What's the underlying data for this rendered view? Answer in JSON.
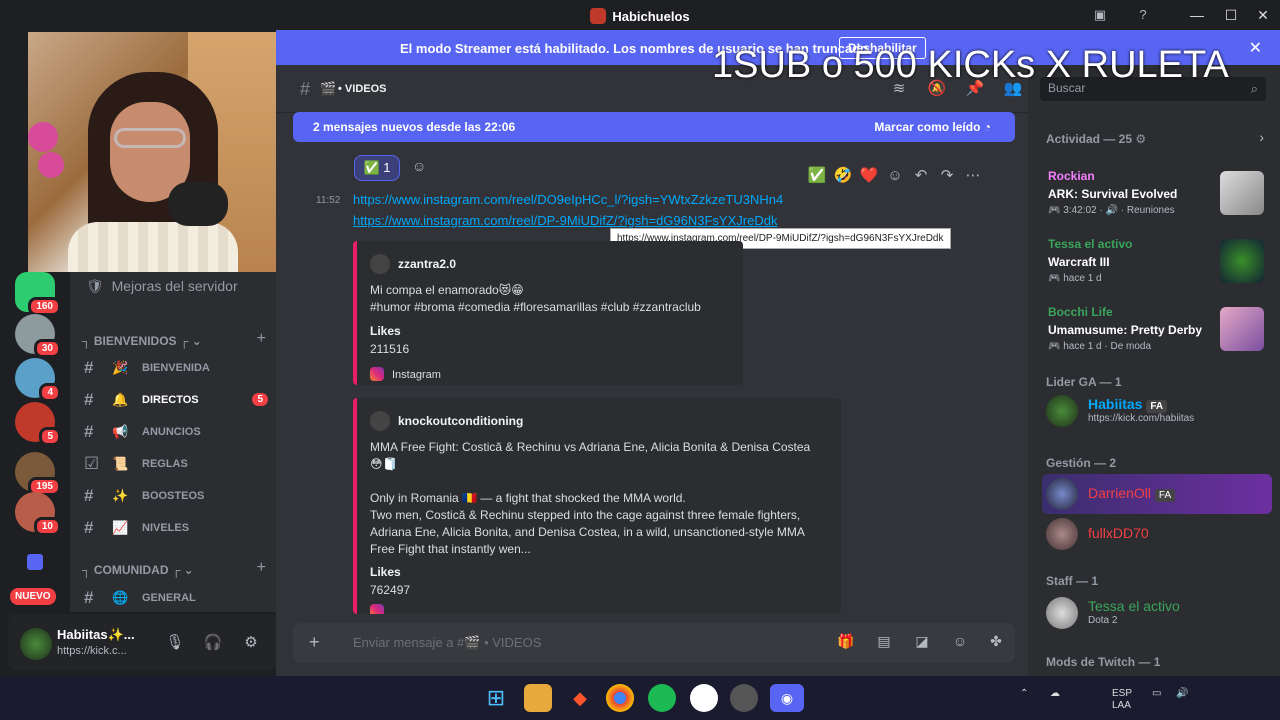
{
  "window": {
    "title": "Habichuelos"
  },
  "streamer_banner": {
    "message": "El modo Streamer está habilitado. Los nombres de usuario se han truncado.",
    "button": "Deshabilitar"
  },
  "stream_overlay": {
    "text": "1SUB  o 500 KICKs X RULETA"
  },
  "servers": [
    {
      "badge": "160",
      "color": "#2ecc71"
    },
    {
      "badge": "30",
      "color": "#8d9a9e"
    },
    {
      "badge": "4",
      "color": "#5aa0c8"
    },
    {
      "badge": "5",
      "color": "#c0392b"
    },
    {
      "badge": "195",
      "color": "#7a5a3a"
    },
    {
      "badge": "10",
      "color": "#b85d4a"
    }
  ],
  "new_label": "NUEVO",
  "channels": {
    "boost_label": "Mejoras del servidor",
    "categories": [
      {
        "name": "BIENVENIDOS"
      },
      {
        "name": "COMUNIDAD"
      }
    ],
    "items": [
      {
        "name": "BIENVENIDA",
        "emoji": "🎉",
        "badge": ""
      },
      {
        "name": "DIRECTOS",
        "emoji": "🔔",
        "badge": "5"
      },
      {
        "name": "ANUNCIOS",
        "emoji": "📢",
        "badge": ""
      },
      {
        "name": "REGLAS",
        "emoji": "📜",
        "badge": ""
      },
      {
        "name": "BOOSTEOS",
        "emoji": "✨",
        "badge": ""
      },
      {
        "name": "NIVELES",
        "emoji": "📈",
        "badge": ""
      },
      {
        "name": "GENERAL",
        "emoji": "🌐",
        "badge": ""
      }
    ]
  },
  "user": {
    "name": "Habiitas✨...",
    "status": "https://kick.c..."
  },
  "channel_header": {
    "name": "VIDEOS"
  },
  "new_messages": {
    "text": "2 mensajes nuevos desde las 22:06",
    "action": "Marcar como leído"
  },
  "reaction": {
    "emoji": "✅",
    "count": "1"
  },
  "message": {
    "time": "11:52",
    "link1": "https://www.instagram.com/reel/DO9eIpHCc_l/?igsh=YWtxZzkzeTU3NHn4",
    "link2": "https://www.instagram.com/reel/DP-9MiUDifZ/?igsh=dG96N3FsYXJreDdk",
    "tooltip": "https://www.instagram.com/reel/DP-9MiUDifZ/?igsh=dG96N3FsYXJreDdk"
  },
  "embed1": {
    "author": "zzantra2.0",
    "line1": "Mi compa el enamorado😻😁",
    "line2": "#humor #broma #comedia #floresamarillas #club #zzantraclub",
    "label": "Likes",
    "value": "211516",
    "footer": "Instagram"
  },
  "embed2": {
    "author": "knockoutconditioning",
    "line1": "MMA Free Fight: Costică & Rechinu vs Adriana Ene, Alicia Bonita & Denisa Costea",
    "line2": "😳🧻",
    "line3": "Only in Romania 🇷🇴 — a fight that shocked the MMA world.",
    "line4": "Two men, Costică & Rechinu stepped into the cage against three female fighters,",
    "line5": "Adriana Ene, Alicia Bonita, and Denisa Costea, in a wild, unsanctioned-style MMA",
    "line6": "Free Fight that instantly wen...",
    "label": "Likes",
    "value": "762497"
  },
  "composer": {
    "placeholder": "Enviar mensaje a #🎬 • VIDEOS"
  },
  "members": {
    "search_placeholder": "Buscar",
    "activity_header": "Actividad — 25",
    "activities": [
      {
        "who": "Rockian",
        "who_color": "#f47fff",
        "what": "ARK: Survival Evolved",
        "detail": "🎮 3:42:02 · 🔊 · Reuniones"
      },
      {
        "who": "Tessa el activo",
        "who_color": "#3ba55c",
        "what": "Warcraft III",
        "detail": "🎮 hace 1 d"
      },
      {
        "who": "Bocchi Life",
        "who_color": "#3ba55c",
        "what": "Umamusume: Pretty Derby",
        "detail": "🎮 hace 1 d · De moda"
      }
    ],
    "groups": [
      {
        "header": "Lider GA — 1",
        "name": "Habiitas",
        "name_color": "#00a8fc",
        "tag": "FA",
        "status": "https://kick.com/habiitas"
      },
      {
        "header": "Gestión — 2",
        "name": "DarrienOll",
        "name_color": "#f23f43",
        "tag": "FA",
        "status": ""
      },
      {
        "header": "",
        "name": "fullxDD70",
        "name_color": "#f23f43",
        "tag": "",
        "status": ""
      },
      {
        "header": "Staff — 1",
        "name": "Tessa el activo",
        "name_color": "#3ba55c",
        "tag": "",
        "status": "Dota 2"
      }
    ],
    "twitch_header": "Mods de Twitch — 1"
  },
  "taskbar": {
    "lang": "ESP",
    "lang2": "LAA"
  }
}
